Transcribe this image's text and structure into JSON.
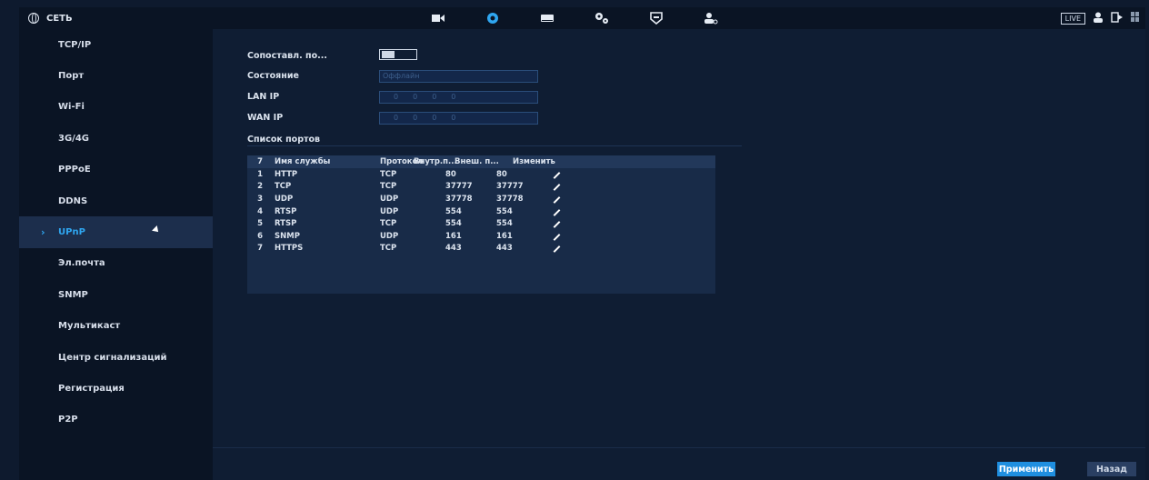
{
  "header": {
    "section_title": "СЕТЬ",
    "nav_icons": [
      "camera-icon",
      "network-icon",
      "storage-icon",
      "settings-icon",
      "security-icon",
      "account-icon"
    ],
    "active_icon": "network-icon",
    "live_label": "LIVE"
  },
  "sidebar": {
    "items": [
      {
        "label": "TCP/IP"
      },
      {
        "label": "Порт"
      },
      {
        "label": "Wi-Fi"
      },
      {
        "label": "3G/4G"
      },
      {
        "label": "PPPoE"
      },
      {
        "label": "DDNS"
      },
      {
        "label": "UPnP",
        "active": true
      },
      {
        "label": "Эл.почта"
      },
      {
        "label": "SNMP"
      },
      {
        "label": "Мультикаст"
      },
      {
        "label": "Центр сигнализаций"
      },
      {
        "label": "Регистрация"
      },
      {
        "label": "P2P"
      }
    ]
  },
  "form": {
    "mapping_label": "Сопоставл. по...",
    "mapping_enabled": true,
    "status_label": "Состояние",
    "status_value": "Оффлайн",
    "lan_ip_label": "LAN IP",
    "lan_ip_value": [
      "0",
      "0",
      "0",
      "0"
    ],
    "wan_ip_label": "WAN IP",
    "wan_ip_value": [
      "0",
      "0",
      "0",
      "0"
    ],
    "port_list_label": "Список портов"
  },
  "table": {
    "headers": [
      "7",
      "Имя службы",
      "Протокол",
      "Внутр.п...",
      "Внеш. п...",
      "Изменить"
    ],
    "rows": [
      [
        "1",
        "HTTP",
        "TCP",
        "80",
        "80"
      ],
      [
        "2",
        "TCP",
        "TCP",
        "37777",
        "37777"
      ],
      [
        "3",
        "UDP",
        "UDP",
        "37778",
        "37778"
      ],
      [
        "4",
        "RTSP",
        "UDP",
        "554",
        "554"
      ],
      [
        "5",
        "RTSP",
        "TCP",
        "554",
        "554"
      ],
      [
        "6",
        "SNMP",
        "UDP",
        "161",
        "161"
      ],
      [
        "7",
        "HTTPS",
        "TCP",
        "443",
        "443"
      ]
    ]
  },
  "buttons": {
    "apply": "Применить",
    "back": "Назад"
  }
}
